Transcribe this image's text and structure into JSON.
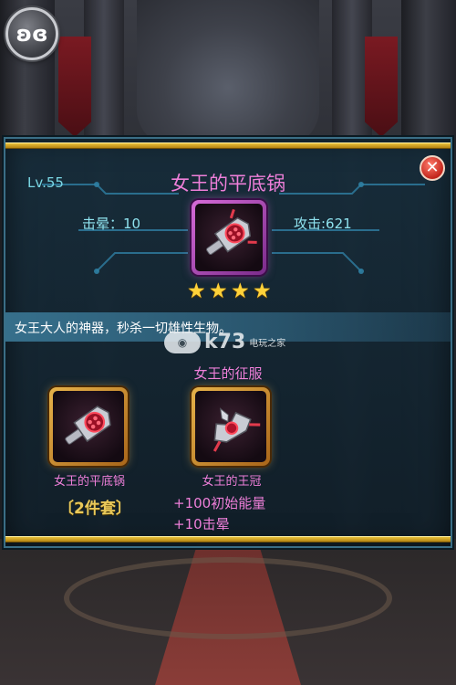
{
  "menu": {
    "icon": "butterfly-icon",
    "glyph": "ʚɞ"
  },
  "item": {
    "level": "Lv.55",
    "name": "女王的平底锅",
    "stun_label": "击晕：10",
    "attack_label": "攻击:621",
    "stars": 4,
    "description": "女王大人的神器，秒杀一切雄性生物。",
    "icon": "frying-pan-icon"
  },
  "set": {
    "title": "女王的征服",
    "pieces": [
      {
        "name": "女王的平底锅",
        "icon": "frying-pan-icon"
      },
      {
        "name": "女王的王冠",
        "icon": "crown-icon"
      }
    ],
    "count_label": "〔2件套〕",
    "bonuses": [
      "+100初始能量",
      "+10击晕"
    ]
  },
  "watermark": {
    "text": "k73",
    "sub": "电玩之家"
  },
  "close": {
    "icon": "close-icon",
    "glyph": "✕"
  },
  "colors": {
    "accent_pink": "#ee7fd9",
    "stat_cyan": "#8fe3ef",
    "gold": "#e9c13a",
    "star": "#ffd23a"
  }
}
